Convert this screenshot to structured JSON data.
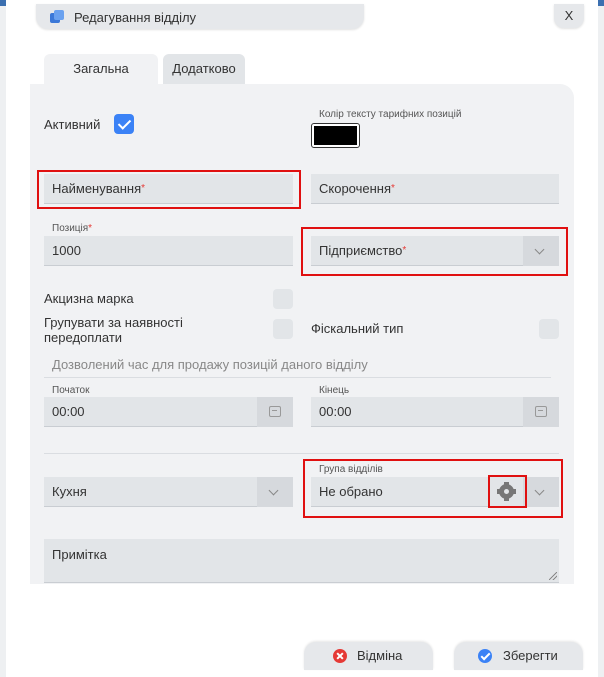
{
  "dialog": {
    "title": "Редагування відділу",
    "close_label": "X"
  },
  "tabs": [
    {
      "label": "Загальна",
      "active": true
    },
    {
      "label": "Додатково",
      "active": false
    }
  ],
  "form": {
    "active_label": "Активний",
    "active_checked": true,
    "text_color_label": "Колір тексту тарифних позицій",
    "text_color_value": "#000000",
    "name_placeholder": "Найменування",
    "short_name_placeholder": "Скорочення",
    "position_label": "Позиція",
    "position_value": "1000",
    "enterprise_placeholder": "Підприємство",
    "required_mark": "*",
    "excise_label": "Акцизна марка",
    "excise_checked": false,
    "group_prepay_label": "Групувати за наявності передоплати",
    "group_prepay_checked": false,
    "fiscal_type_label": "Фіскальний тип",
    "fiscal_type_checked": false,
    "sale_time_caption": "Дозволений час для продажу позицій даного відділу",
    "start_label": "Початок",
    "start_value": "00:00",
    "end_label": "Кінець",
    "end_value": "00:00",
    "kitchen_value": "Кухня",
    "department_group_label": "Група відділів",
    "department_group_value": "Не обрано",
    "note_placeholder": "Примітка"
  },
  "footer": {
    "cancel_label": "Відміна",
    "save_label": "Зберегти"
  },
  "colors": {
    "accent": "#3b82f6",
    "highlight": "#e01010",
    "cancel": "#e53935"
  }
}
